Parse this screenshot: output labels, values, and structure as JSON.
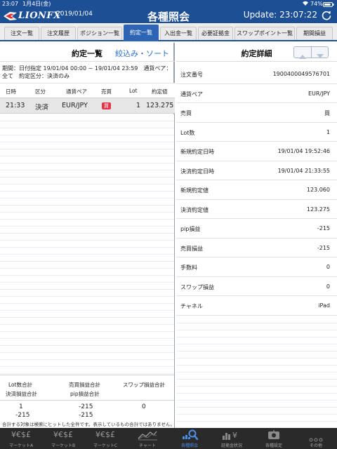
{
  "status": {
    "time": "23:07",
    "date": "1月4日(金)",
    "battery": "74%"
  },
  "header": {
    "logo": "LIONFX",
    "date": "2019/01/04",
    "title": "各種照会",
    "update": "Update: 23:07:22"
  },
  "tabs": [
    {
      "label": "注文一覧",
      "active": false
    },
    {
      "label": "注文履歴",
      "active": false
    },
    {
      "label": "ポジション一覧",
      "active": false
    },
    {
      "label": "約定一覧",
      "active": true
    },
    {
      "label": "入出金一覧",
      "active": false
    },
    {
      "label": "必要証拠金",
      "active": false
    },
    {
      "label": "スワップポイント一覧",
      "active": false
    },
    {
      "label": "期間損益",
      "active": false
    }
  ],
  "left": {
    "title": "約定一覧",
    "filter_link": "絞込み・ソート",
    "period_line1": "期間：日付指定 19/01/04 00:00 ~ 19/01/04 23:59　通貨ペア：",
    "period_line2": "全て　約定区分：決済のみ",
    "columns": {
      "datetime": "日時",
      "kind": "区分",
      "pair": "通貨ペア",
      "side": "売買",
      "lot": "Lot",
      "price": "約定値"
    },
    "row": {
      "datetime": "21:33",
      "kind": "決済",
      "pair": "EUR/JPY",
      "side": "買",
      "lot": "1",
      "price": "123.275"
    },
    "totals": {
      "lot_total_label": "Lot数合計",
      "pl_total_label": "売買損益合計",
      "swap_total_label": "スワップ損益合計",
      "settle_total_label": "決済損益合計",
      "pip_total_label": "pip損益合計",
      "lot_total": "1",
      "pl_total": "-215",
      "swap_total": "0",
      "settle_total": "-215",
      "pip_total": "-215",
      "note": "合計する対象は検索にヒットした全件です。表示しているもの合計ではありません。"
    }
  },
  "right": {
    "title": "約定詳細",
    "details": [
      {
        "label": "注文番号",
        "value": "1900400049576701"
      },
      {
        "label": "通貨ペア",
        "value": "EUR/JPY"
      },
      {
        "label": "売買",
        "value": "買"
      },
      {
        "label": "Lot数",
        "value": "1"
      },
      {
        "label": "新規約定日時",
        "value": "19/01/04 19:52:46"
      },
      {
        "label": "決済約定日時",
        "value": "19/01/04 21:33:55"
      },
      {
        "label": "新規約定値",
        "value": "123.060"
      },
      {
        "label": "決済約定値",
        "value": "123.275"
      },
      {
        "label": "pip損益",
        "value": "-215"
      },
      {
        "label": "売買損益",
        "value": "-215"
      },
      {
        "label": "手数料",
        "value": "0"
      },
      {
        "label": "スワップ損益",
        "value": "0"
      },
      {
        "label": "チャネル",
        "value": "iPad"
      }
    ]
  },
  "bottom_nav": [
    {
      "icon": "¥€$£",
      "label": "マーケットA",
      "active": false
    },
    {
      "icon": "¥€$£",
      "label": "マーケットB",
      "active": false
    },
    {
      "icon": "¥€$£",
      "label": "マーケットC",
      "active": false
    },
    {
      "icon": "chart-icon",
      "label": "チャート",
      "active": false
    },
    {
      "icon": "search-icon",
      "label": "各種照会",
      "active": true
    },
    {
      "icon": "bar-yen-icon",
      "label": "証拠金状況",
      "active": false
    },
    {
      "icon": "gear-icon",
      "label": "各種設定",
      "active": false
    },
    {
      "icon": "more-icon",
      "label": "その他",
      "active": false
    }
  ],
  "colors": {
    "brand": "#1d4f95",
    "active_tab": "#2d64b4",
    "link": "#2b6fc7",
    "buy_badge": "#e0364a",
    "nav_active": "#4b8fe6"
  }
}
